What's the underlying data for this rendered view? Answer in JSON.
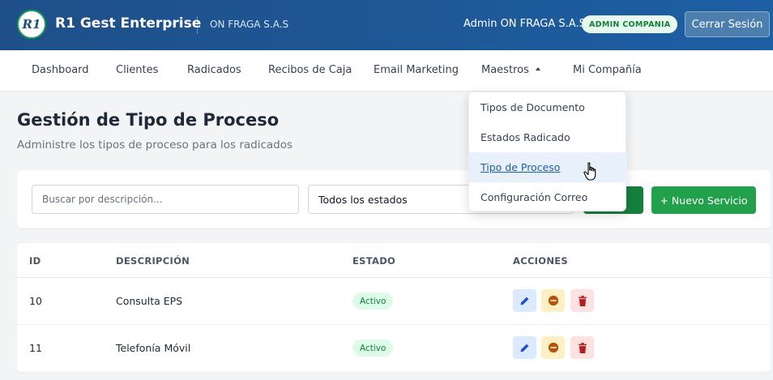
{
  "header": {
    "logo_text": "R1",
    "app_title": "R1 Gest Enterprise",
    "company_name": "ON FRAGA S.A.S",
    "user_name": "Admin ON FRAGA S.A.S",
    "role_badge": "ADMIN COMPANIA",
    "logout_label": "Cerrar Sesión"
  },
  "nav": {
    "items": [
      "Dashboard",
      "Clientes",
      "Radicados",
      "Recibos de Caja",
      "Email Marketing",
      "Maestros",
      "Mi Compañía"
    ]
  },
  "dropdown": {
    "items": [
      "Tipos de Documento",
      "Estados Radicado",
      "Tipo de Proceso",
      "Configuración Correo"
    ],
    "active_index": 2
  },
  "page": {
    "title": "Gestión de Tipo de Proceso",
    "subtitle": "Administre los tipos de proceso para los radicados"
  },
  "filters": {
    "search_placeholder": "Buscar por descripción...",
    "status_value": "Todos los estados",
    "new_button": "+ Nuevo Servicio"
  },
  "table": {
    "headers": [
      "ID",
      "DESCRIPCIÓN",
      "ESTADO",
      "ACCIONES"
    ],
    "rows": [
      {
        "id": "10",
        "description": "Consulta EPS",
        "status": "Activo"
      },
      {
        "id": "11",
        "description": "Telefonía Móvil",
        "status": "Activo"
      }
    ]
  },
  "colors": {
    "header_bg": "#1e4f88",
    "primary_green": "#22a04b",
    "status_green": "#15803d"
  },
  "icons": {
    "edit": "pencil-icon",
    "toggle": "minus-circle-icon",
    "delete": "trash-icon",
    "caret": "caret-up-icon",
    "cursor": "hand-pointer-icon"
  }
}
